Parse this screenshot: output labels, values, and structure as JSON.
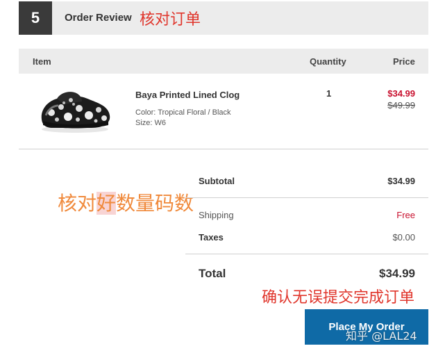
{
  "step": {
    "number": "5",
    "title": "Order Review"
  },
  "annotations": {
    "header_note": "核对订单",
    "middle_note_a": "核对",
    "middle_note_b": "好",
    "middle_note_c": "数量码数",
    "bottom_note": "确认无误提交完成订单",
    "watermark": "知乎 @LAL24"
  },
  "table": {
    "headers": {
      "item": "Item",
      "quantity": "Quantity",
      "price": "Price"
    }
  },
  "product": {
    "image_icon": "clog-shoe-image",
    "name": "Baya Printed Lined Clog",
    "color_line": "Color:  Tropical Floral / Black",
    "size_line": "Size:  W6",
    "quantity": "1",
    "sale_price": "$34.99",
    "original_price": "$49.99"
  },
  "summary": {
    "subtotal_label": "Subtotal",
    "subtotal_value": "$34.99",
    "shipping_label": "Shipping",
    "shipping_value": "Free",
    "taxes_label": "Taxes",
    "taxes_value": "$0.00",
    "total_label": "Total",
    "total_value": "$34.99"
  },
  "actions": {
    "place_order_label": "Place My Order"
  },
  "colors": {
    "accent_blue": "#0f6aa6",
    "sale_red": "#c8102e",
    "annotation_red": "#e0352b",
    "annotation_orange": "#f08a3c",
    "header_gray": "#ececec",
    "step_dark": "#3a3a3a"
  }
}
